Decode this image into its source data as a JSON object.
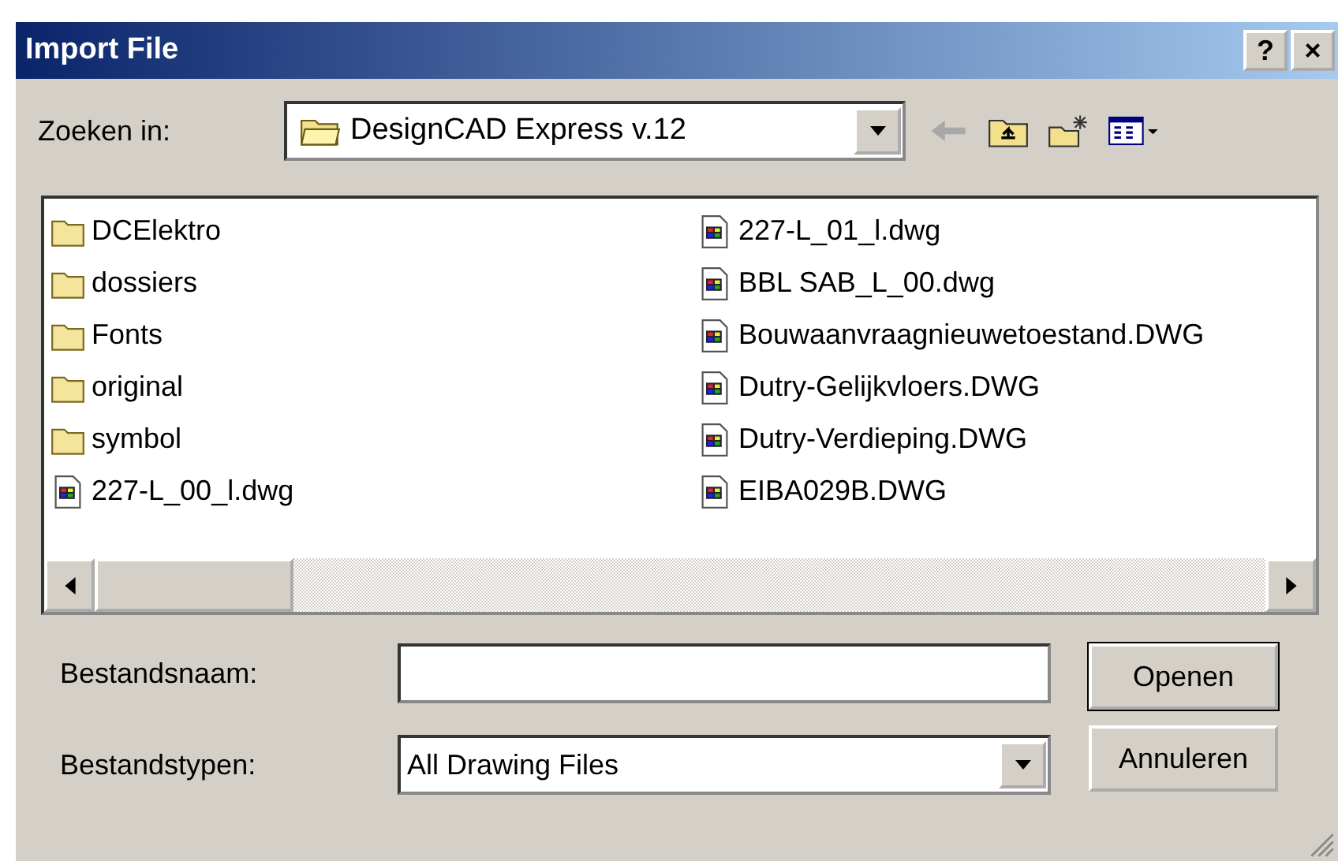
{
  "window": {
    "title": "Import File",
    "help_button": "?",
    "close_button": "×"
  },
  "look_in": {
    "label": "Zoeken in:",
    "value": "DesignCAD Express v.12"
  },
  "files": [
    {
      "name": "DCElektro",
      "kind": "folder"
    },
    {
      "name": "dossiers",
      "kind": "folder"
    },
    {
      "name": "Fonts",
      "kind": "folder"
    },
    {
      "name": "original",
      "kind": "folder"
    },
    {
      "name": "symbol",
      "kind": "folder"
    },
    {
      "name": "227-L_00_l.dwg",
      "kind": "drawing"
    },
    {
      "name": "227-L_01_l.dwg",
      "kind": "drawing"
    },
    {
      "name": "BBL SAB_L_00.dwg",
      "kind": "drawing"
    },
    {
      "name": "Bouwaanvraagnieuwetoestand.DWG",
      "kind": "drawing"
    },
    {
      "name": "Dutry-Gelijkvloers.DWG",
      "kind": "drawing"
    },
    {
      "name": "Dutry-Verdieping.DWG",
      "kind": "drawing"
    },
    {
      "name": "EIBA029B.DWG",
      "kind": "drawing"
    }
  ],
  "file_name": {
    "label": "Bestandsnaam:"
  },
  "file_type": {
    "label": "Bestandstypen:",
    "value": "All Drawing Files"
  },
  "buttons": [
    {
      "label": "Openen",
      "default": true
    },
    {
      "label": "Annuleren",
      "default": false
    }
  ]
}
